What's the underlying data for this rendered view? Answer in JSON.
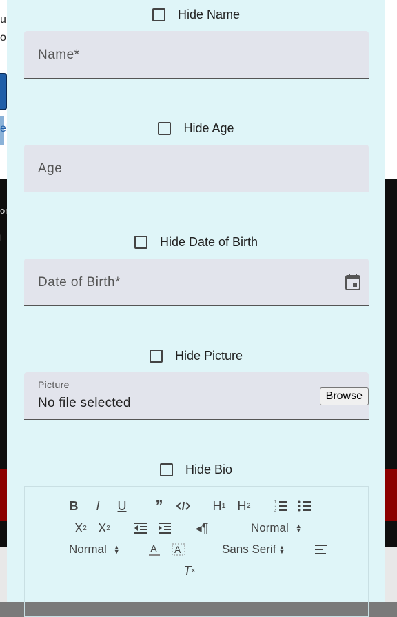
{
  "background": {
    "fragments": [
      "u",
      "o",
      "el",
      "or",
      "l"
    ]
  },
  "form": {
    "name": {
      "hide_label": "Hide Name",
      "label": "Name*"
    },
    "age": {
      "hide_label": "Hide Age",
      "label": "Age"
    },
    "dob": {
      "hide_label": "Hide Date of Birth",
      "label": "Date of Birth*"
    },
    "picture": {
      "hide_label": "Hide Picture",
      "label": "Picture",
      "value": "No file selected",
      "browse": "Browse"
    },
    "bio": {
      "hide_label": "Hide Bio"
    }
  },
  "toolbar": {
    "header_select": "Normal",
    "size_select": "Normal",
    "font_select": "Sans Serif",
    "icons": [
      "bold-icon",
      "italic-icon",
      "underline-icon",
      "blockquote-icon",
      "code-icon",
      "h1-icon",
      "h2-icon",
      "ordered-list-icon",
      "bullet-list-icon",
      "subscript-icon",
      "superscript-icon",
      "outdent-icon",
      "indent-icon",
      "rtl-icon",
      "text-color-icon",
      "background-color-icon",
      "align-icon",
      "clear-format-icon"
    ]
  },
  "colors": {
    "modal_bg": "#dff5f8",
    "field_bg": "#e2e4ec",
    "overlay_red": "#8b0000"
  }
}
